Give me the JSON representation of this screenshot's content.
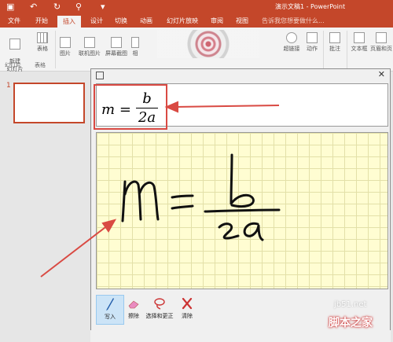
{
  "window": {
    "title": "演示文稿1 - PowerPoint"
  },
  "tabs": [
    "文件",
    "开始",
    "插入",
    "设计",
    "切换",
    "动画",
    "幻灯片放映",
    "审阅",
    "视图"
  ],
  "tell_me": "告诉我您想要做什么...",
  "ribbon": {
    "new_slide": "新建\n幻灯片",
    "table": "表格",
    "picture": "图片",
    "online_picture": "联机图片",
    "screenshot": "屏幕截图",
    "album": "相",
    "link": "超链接",
    "action": "动作",
    "comment": "批注",
    "textbox": "文本框",
    "header_footer": "页眉和页",
    "group_slides": "幻灯片",
    "group_tables": "表格"
  },
  "slide_panel": {
    "slide_number": "1"
  },
  "math_input": {
    "preview_formula": {
      "lhs": "m",
      "op": "=",
      "numerator": "b",
      "denominator": "2a"
    },
    "tools": [
      {
        "label": "写入",
        "icon": "pen-icon",
        "active": true
      },
      {
        "label": "擦除",
        "icon": "eraser-icon",
        "active": false
      },
      {
        "label": "选择和更正",
        "icon": "lasso-icon",
        "active": false
      },
      {
        "label": "清除",
        "icon": "clear-icon",
        "active": false
      }
    ]
  },
  "watermark": {
    "site": "jb51.net",
    "name": "脚本之家"
  },
  "colors": {
    "accent": "#c4472a",
    "annotation": "#d94a43",
    "canvas": "#fffdd2"
  }
}
